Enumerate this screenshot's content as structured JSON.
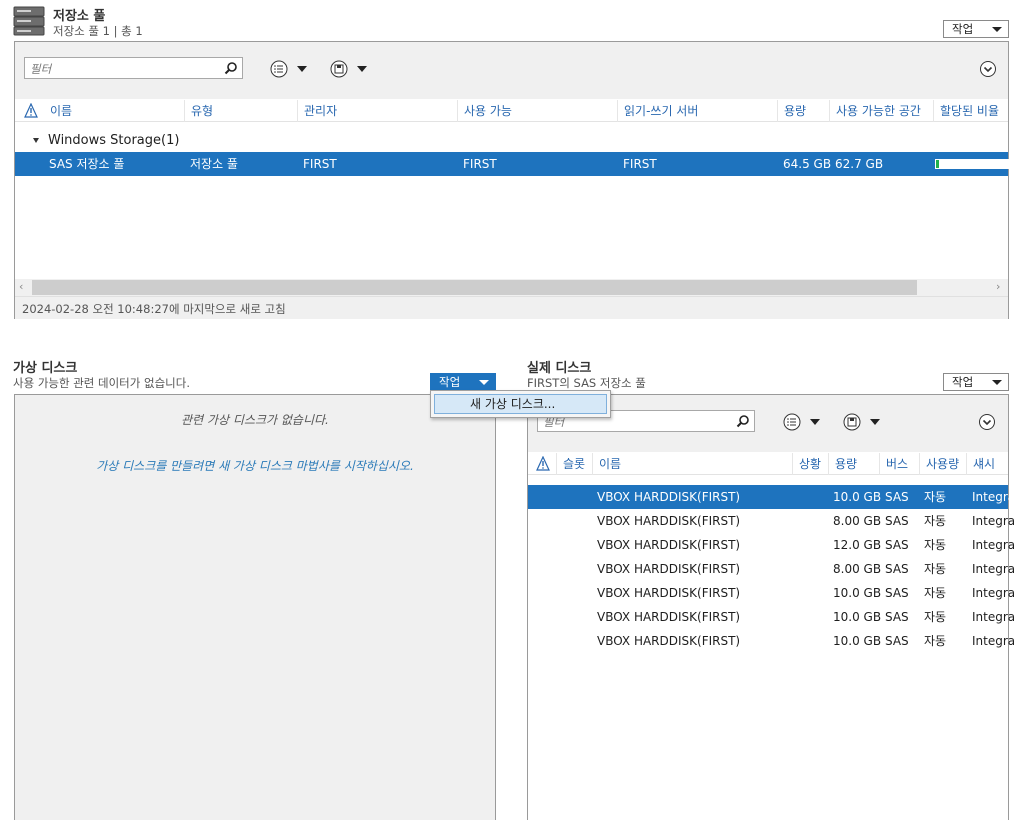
{
  "pool_section": {
    "title": "저장소 풀",
    "subtitle": "저장소 풀 1 | 총 1",
    "task_label": "작업",
    "filter_placeholder": "필터",
    "columns": [
      "이름",
      "유형",
      "관리자",
      "사용 가능",
      "읽기-쓰기 서버",
      "용량",
      "사용 가능한 공간",
      "할당된 비율"
    ],
    "group_label": "Windows Storage(1)",
    "rows": [
      {
        "name": "SAS 저장소 풀",
        "type": "저장소 풀",
        "manager": "FIRST",
        "available": "FIRST",
        "rw_server": "FIRST",
        "capacity": "64.5 GB",
        "free": "62.7 GB",
        "allocated_fraction": 0.03
      }
    ],
    "status": "2024-02-28 오전 10:48:27에 마지막으로 새로 고침"
  },
  "vdisk_section": {
    "title": "가상 디스크",
    "subtitle": "사용 가능한 관련 데이터가 없습니다.",
    "task_label": "작업",
    "empty_title": "관련 가상 디스크가 없습니다.",
    "empty_hint": "가상 디스크를 만들려면 새 가상 디스크 마법사를 시작하십시오.",
    "menu_item": "새 가상 디스크..."
  },
  "pdisk_section": {
    "title": "실제 디스크",
    "subtitle": "FIRST의 SAS 저장소 풀",
    "task_label": "작업",
    "filter_placeholder": "필터",
    "columns": [
      "슬롯",
      "이름",
      "상황",
      "용량",
      "버스",
      "사용량",
      "섀시"
    ],
    "rows": [
      {
        "name": "VBOX HARDDISK(FIRST)",
        "capacity": "10.0 GB",
        "bus": "SAS",
        "usage": "자동",
        "chassis": "Integra"
      },
      {
        "name": "VBOX HARDDISK(FIRST)",
        "capacity": "8.00 GB",
        "bus": "SAS",
        "usage": "자동",
        "chassis": "Integra"
      },
      {
        "name": "VBOX HARDDISK(FIRST)",
        "capacity": "12.0 GB",
        "bus": "SAS",
        "usage": "자동",
        "chassis": "Integra"
      },
      {
        "name": "VBOX HARDDISK(FIRST)",
        "capacity": "8.00 GB",
        "bus": "SAS",
        "usage": "자동",
        "chassis": "Integra"
      },
      {
        "name": "VBOX HARDDISK(FIRST)",
        "capacity": "10.0 GB",
        "bus": "SAS",
        "usage": "자동",
        "chassis": "Integra"
      },
      {
        "name": "VBOX HARDDISK(FIRST)",
        "capacity": "10.0 GB",
        "bus": "SAS",
        "usage": "자동",
        "chassis": "Integra"
      },
      {
        "name": "VBOX HARDDISK(FIRST)",
        "capacity": "10.0 GB",
        "bus": "SAS",
        "usage": "자동",
        "chassis": "Integra"
      }
    ]
  },
  "colors": {
    "accent": "#1e73be",
    "header_text": "#2a68b0",
    "empty_hint": "#2a7ab8",
    "progress": "#22b14c"
  }
}
